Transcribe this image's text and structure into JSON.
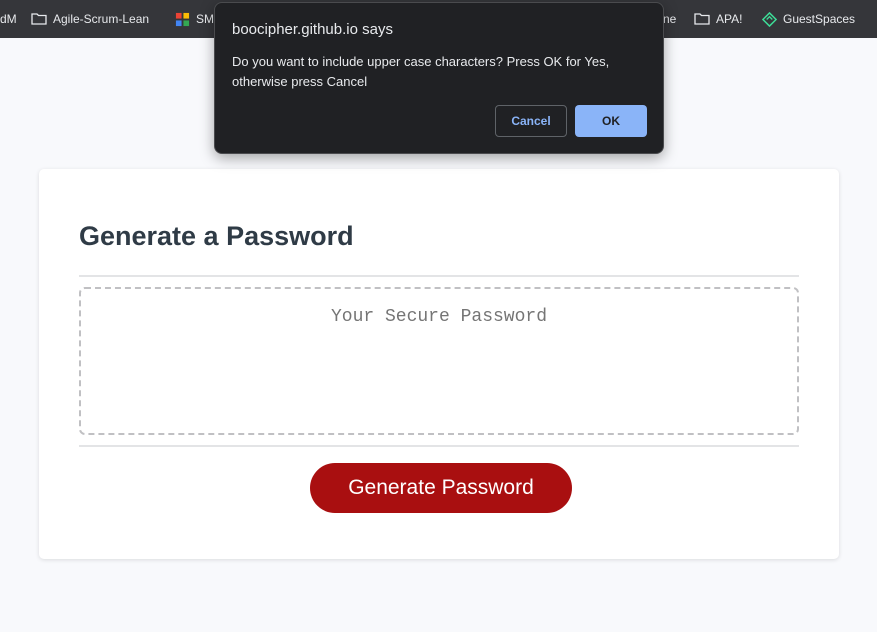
{
  "bookmarks": {
    "items": [
      {
        "label": "dM",
        "icon": "none"
      },
      {
        "label": "Agile-Scrum-Lean",
        "icon": "folder-icon"
      },
      {
        "label": "SM",
        "icon": "app-icon"
      },
      {
        "label": "ne",
        "icon": "none"
      },
      {
        "label": "APA!",
        "icon": "folder-icon"
      },
      {
        "label": "GuestSpaces",
        "icon": "guestspaces-icon"
      }
    ]
  },
  "dialog": {
    "title": "boocipher.github.io says",
    "message": "Do you want to include upper case characters? Press OK for Yes, otherwise press Cancel",
    "cancel_label": "Cancel",
    "ok_label": "OK"
  },
  "card": {
    "title": "Generate a Password",
    "password_placeholder": "Your Secure Password",
    "generate_label": "Generate Password"
  },
  "colors": {
    "accent_button": "#a90f10",
    "dialog_ok": "#8ab4f8",
    "bookmarks_bar": "#35363a"
  }
}
